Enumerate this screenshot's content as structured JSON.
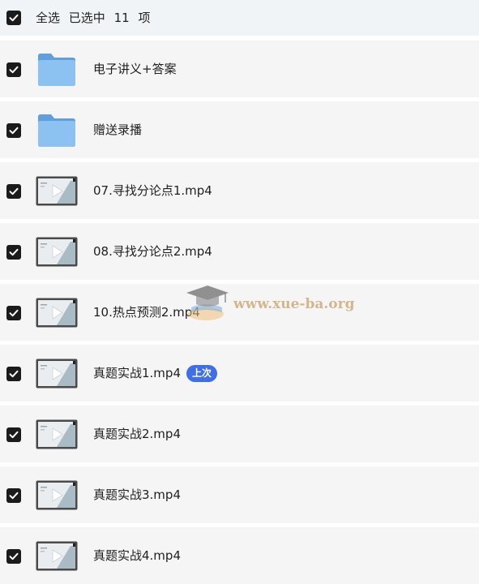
{
  "header": {
    "select_all_label": "全选",
    "selected_prefix": "已选中",
    "selected_count": "11",
    "selected_suffix": "项"
  },
  "items": [
    {
      "name": "电子讲义+答案",
      "type": "folder",
      "checked": true
    },
    {
      "name": "赠送录播",
      "type": "folder",
      "checked": true
    },
    {
      "name": "07.寻找分论点1.mp4",
      "type": "video",
      "checked": true
    },
    {
      "name": "08.寻找分论点2.mp4",
      "type": "video",
      "checked": true
    },
    {
      "name": "10.热点预测2.mp4",
      "type": "video",
      "checked": true
    },
    {
      "name": "真题实战1.mp4",
      "type": "video",
      "checked": true,
      "badge": "上次"
    },
    {
      "name": "真题实战2.mp4",
      "type": "video",
      "checked": true
    },
    {
      "name": "真题实战3.mp4",
      "type": "video",
      "checked": true
    },
    {
      "name": "真题实战4.mp4",
      "type": "video",
      "checked": true
    }
  ],
  "watermark": {
    "text": "www.xue-ba.org"
  },
  "colors": {
    "header_bg": "#f1f4f6",
    "row_bg": "#f5f5f5",
    "checkbox": "#1b1b1b",
    "folder": "#7ab5ec",
    "badge_bg": "#3f6ee8"
  }
}
